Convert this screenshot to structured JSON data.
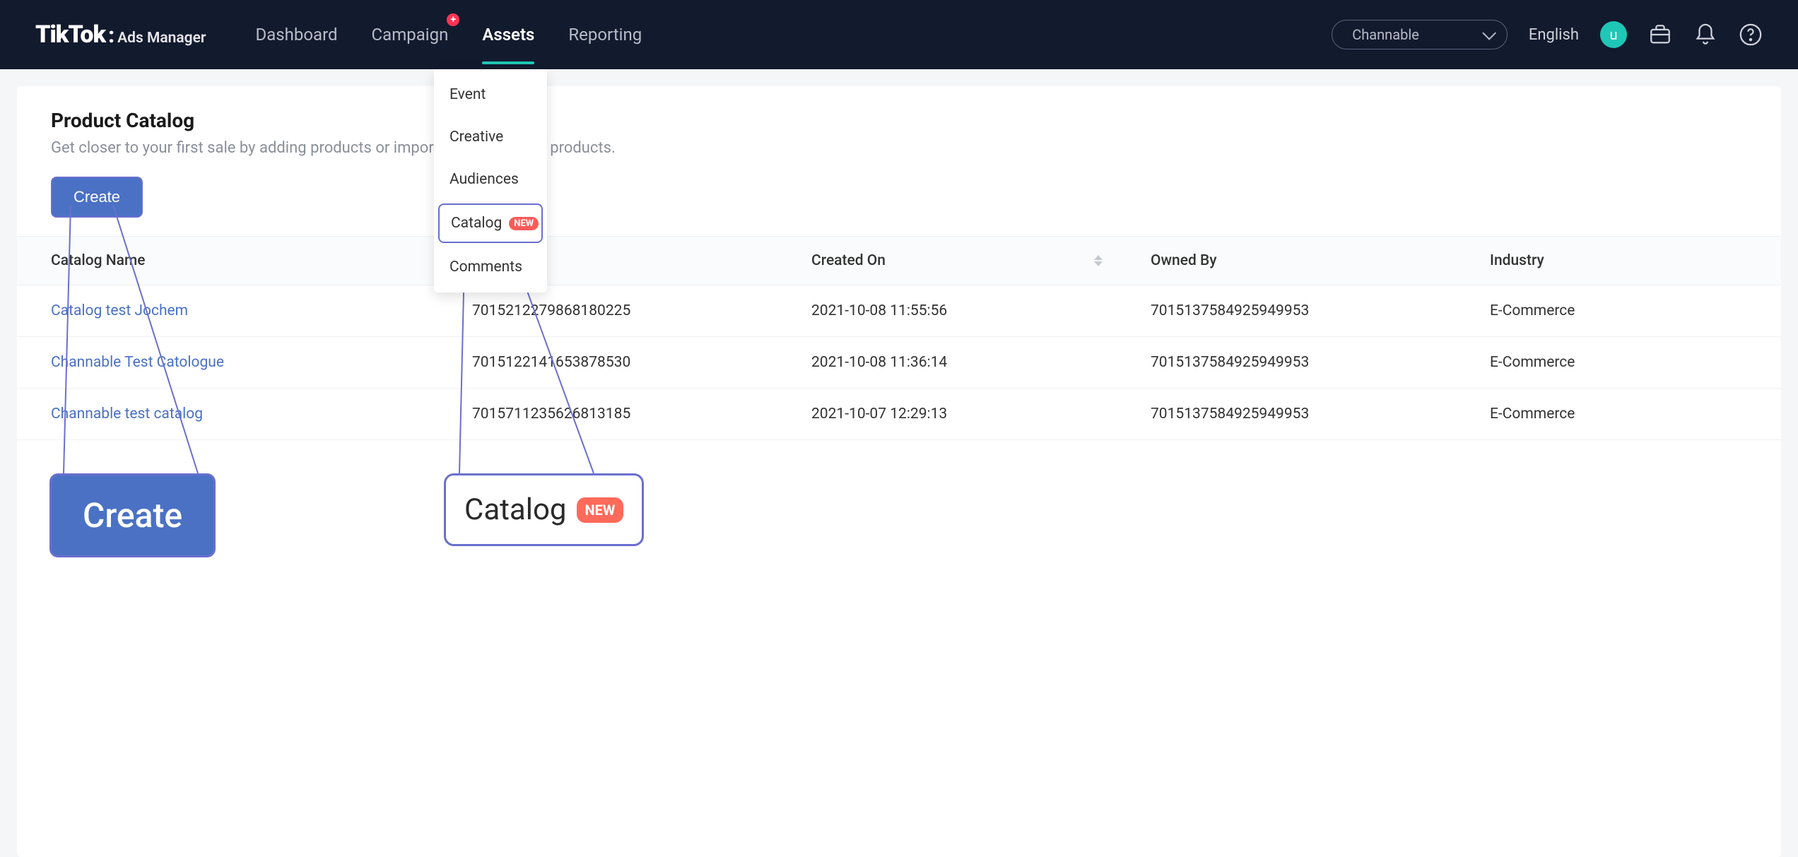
{
  "logo": {
    "main": "TikTok",
    "suffix": "Ads Manager"
  },
  "nav": {
    "items": [
      {
        "label": "Dashboard",
        "active": false,
        "badge": false
      },
      {
        "label": "Campaign",
        "active": false,
        "badge": true
      },
      {
        "label": "Assets",
        "active": true,
        "badge": false
      },
      {
        "label": "Reporting",
        "active": false,
        "badge": false
      }
    ]
  },
  "dropdown": {
    "items": [
      {
        "label": "Event",
        "new": false,
        "highlight": false
      },
      {
        "label": "Creative",
        "new": false,
        "highlight": false
      },
      {
        "label": "Audiences",
        "new": false,
        "highlight": false
      },
      {
        "label": "Catalog",
        "new": true,
        "highlight": true
      },
      {
        "label": "Comments",
        "new": false,
        "highlight": false
      }
    ],
    "new_badge_text": "NEW"
  },
  "account_selector": {
    "value": "Channable"
  },
  "language": "English",
  "avatar_initial": "u",
  "page": {
    "title": "Product Catalog",
    "description": "Get closer to your first sale by adding products or importing a catalog of products.",
    "create_button": "Create"
  },
  "table": {
    "columns": [
      "Catalog Name",
      "",
      "Created On",
      "Owned By",
      "Industry"
    ],
    "rows": [
      {
        "name": "Catalog test Jochem",
        "id": "7015212279868180225",
        "created": "2021-10-08 11:55:56",
        "owner": "7015137584925949953",
        "industry": "E-Commerce"
      },
      {
        "name": "Channable Test Catologue",
        "id": "7015122141653878530",
        "created": "2021-10-08 11:36:14",
        "owner": "7015137584925949953",
        "industry": "E-Commerce"
      },
      {
        "name": "Channable test catalog",
        "id": "7015711235626813185",
        "created": "2021-10-07 12:29:13",
        "owner": "7015137584925949953",
        "industry": "E-Commerce"
      }
    ]
  },
  "callouts": {
    "create": "Create",
    "catalog": "Catalog",
    "catalog_badge": "NEW"
  }
}
